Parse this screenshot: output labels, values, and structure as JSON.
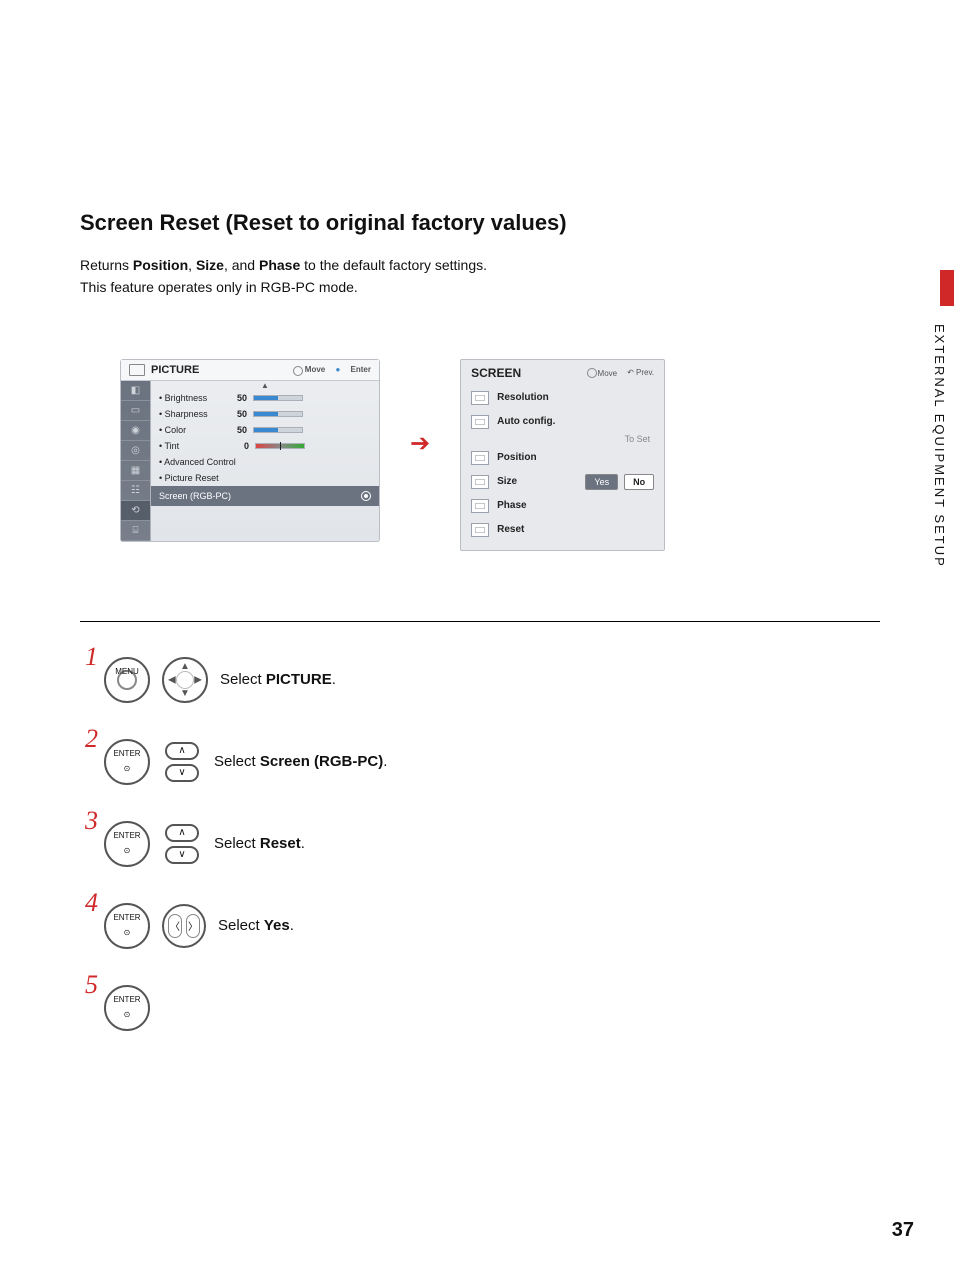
{
  "page": {
    "title": "Screen Reset (Reset to original factory values)",
    "intro_prefix": "Returns ",
    "intro_b1": "Position",
    "intro_sep1": ", ",
    "intro_b2": "Size",
    "intro_sep2": ", and ",
    "intro_b3": "Phase",
    "intro_suffix": " to the default factory settings.",
    "intro_line2": "This feature operates only in RGB-PC mode.",
    "side_tab": "EXTERNAL EQUIPMENT SETUP",
    "page_number": "37"
  },
  "osd_left": {
    "title": "PICTURE",
    "hint_move": "Move",
    "hint_enter": "Enter",
    "rows": [
      {
        "label": "• Brightness",
        "value": "50",
        "type": "bar"
      },
      {
        "label": "• Sharpness",
        "value": "50",
        "type": "bar"
      },
      {
        "label": "• Color",
        "value": "50",
        "type": "bar"
      },
      {
        "label": "• Tint",
        "value": "0",
        "type": "tint"
      },
      {
        "label": "• Advanced Control",
        "value": "",
        "type": "plain"
      },
      {
        "label": "• Picture Reset",
        "value": "",
        "type": "plain"
      }
    ],
    "selected": "Screen (RGB-PC)"
  },
  "osd_right": {
    "title": "SCREEN",
    "hint_move": "Move",
    "hint_prev": "Prev.",
    "items": [
      "Resolution",
      "Auto config.",
      "Position",
      "Size",
      "Phase",
      "Reset"
    ],
    "to_set": "To Set",
    "yes": "Yes",
    "no": "No"
  },
  "steps": {
    "s1_btn": "MENU",
    "s1_pre": "Select ",
    "s1_bold": "PICTURE",
    "s1_post": ".",
    "s2_btn": "ENTER",
    "s2_pre": "Select ",
    "s2_bold": "Screen (RGB-PC)",
    "s2_post": ".",
    "s3_btn": "ENTER",
    "s3_pre": "Select ",
    "s3_bold": "Reset",
    "s3_post": ".",
    "s4_btn": "ENTER",
    "s4_pre": "Select ",
    "s4_bold": "Yes",
    "s4_post": ".",
    "s5_btn": "ENTER",
    "n1": "1",
    "n2": "2",
    "n3": "3",
    "n4": "4",
    "n5": "5"
  }
}
